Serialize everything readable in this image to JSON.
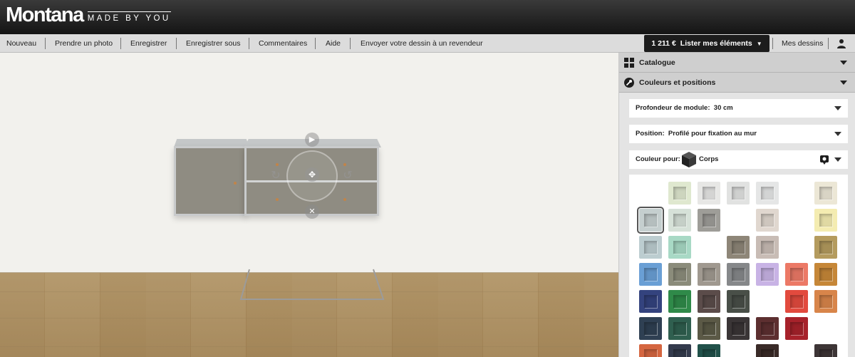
{
  "header": {
    "logo_word": "Montana",
    "logo_tagline": "MADE BY YOU"
  },
  "menu": {
    "items": [
      {
        "label": "Nouveau"
      },
      {
        "label": "Prendre un photo"
      },
      {
        "label": "Enregistrer"
      },
      {
        "label": "Enregistrer sous"
      },
      {
        "label": "Commentaires"
      },
      {
        "label": "Aide"
      },
      {
        "label": "Envoyer votre dessin à un revendeur"
      }
    ],
    "price": "1 211 €",
    "list_label": "Lister mes éléments",
    "my_designs": "Mes dessins",
    "user_icon": "user-icon"
  },
  "panel": {
    "catalogue": {
      "label": "Catalogue",
      "icon": "grid-icon"
    },
    "colors_positions": {
      "label": "Couleurs et positions",
      "icon": "wrench-icon"
    },
    "depth": {
      "label": "Profondeur de module:",
      "value": "30 cm"
    },
    "position": {
      "label": "Position:",
      "value": "Profilé pour fixation au mur"
    },
    "color_for": {
      "label": "Couleur pour:",
      "value": "Corps"
    },
    "swatches": [
      [
        "",
        "#dfe8cf",
        "#e7e7e5",
        "#e1e2e1",
        "#e5e6e6",
        "",
        "#ece7d6"
      ],
      [
        "#c5cfcf",
        "#d6e1d8",
        "#9e9d98",
        "",
        "#e0d7cf",
        "",
        "#f4ecb1"
      ],
      [
        "#bccdd0",
        "#a8d9c5",
        "",
        "#8e8678",
        "#c8bcb5",
        "",
        "#b49b5e"
      ],
      [
        "#6a9fd5",
        "#8b8c7b",
        "#a09990",
        "#86888a",
        "#c8b3e5",
        "#ec7966",
        "#c68738"
      ],
      [
        "#34437e",
        "#2f8a49",
        "#5b4c4a",
        "#494f48",
        "",
        "#e24a3e",
        "#d8854a"
      ],
      [
        "#2f4053",
        "#2f5f4f",
        "#5b5946",
        "#3a3536",
        "#5d2f30",
        "#a7222b",
        ""
      ],
      [
        "#d56640",
        "#343b4d",
        "#21514a",
        "",
        "#3a2b28",
        "",
        "#3d3536"
      ]
    ],
    "selected_swatch": "#c5cfcf"
  }
}
